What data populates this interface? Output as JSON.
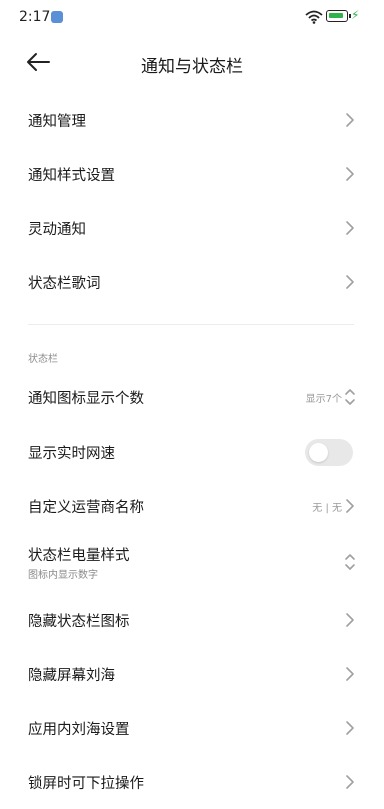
{
  "status_bar": {
    "time": "2:17",
    "battery_color": "#2fb34a",
    "icons": [
      "app-notification-icon",
      "wifi-icon",
      "battery-icon",
      "charging-icon"
    ]
  },
  "header": {
    "title": "通知与状态栏",
    "back_icon": "arrow-left-icon"
  },
  "top_items": [
    {
      "label": "通知管理",
      "icon": "chevron-right-icon"
    },
    {
      "label": "通知样式设置",
      "icon": "chevron-right-icon"
    },
    {
      "label": "灵动通知",
      "icon": "chevron-right-icon"
    },
    {
      "label": "状态栏歌词",
      "icon": "chevron-right-icon"
    }
  ],
  "status_section": {
    "header": "状态栏",
    "items": [
      {
        "label": "通知图标显示个数",
        "value": "显示7个",
        "icon": "up-down-icon"
      },
      {
        "label": "显示实时网速",
        "toggle": "off"
      },
      {
        "label": "自定义运营商名称",
        "value": "无 | 无",
        "icon": "chevron-right-icon"
      },
      {
        "label": "状态栏电量样式",
        "subtitle": "图标内显示数字",
        "icon": "up-down-icon"
      },
      {
        "label": "隐藏状态栏图标",
        "icon": "chevron-right-icon"
      },
      {
        "label": "隐藏屏幕刘海",
        "icon": "chevron-right-icon"
      },
      {
        "label": "应用内刘海设置",
        "icon": "chevron-right-icon"
      },
      {
        "label": "锁屏时可下拉操作",
        "icon": "chevron-right-icon"
      }
    ]
  }
}
